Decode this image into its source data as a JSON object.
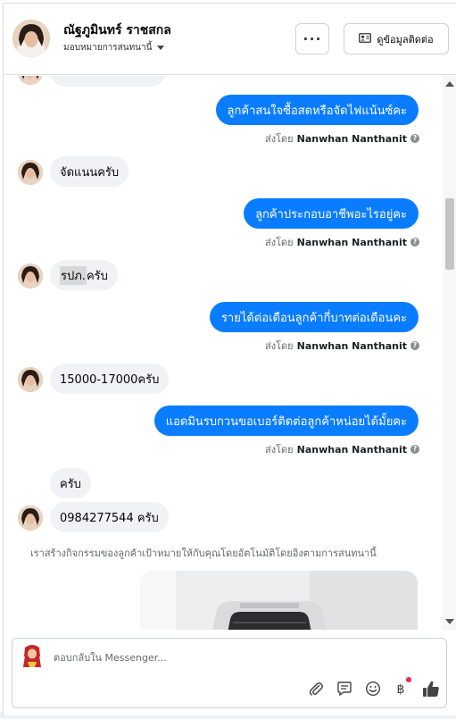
{
  "header": {
    "name": "ณัฐภูมินทร์ ราชสกล",
    "subtitle": "มอบหมายการสนทนานี้",
    "more_label": "···",
    "contact_label": "ดูข้อมูลติดต่อ"
  },
  "messages": [
    {
      "dir": "out",
      "text": "ลูกค้าสนใจซื้อสดหรือจัดไฟแน้นซ์คะ",
      "sent_by_prefix": "ส่งโดย",
      "sent_by_name": "Nanwhan Nanthanit"
    },
    {
      "dir": "in",
      "text": "จัดแนนครับ"
    },
    {
      "dir": "out",
      "text": "ลูกค้าประกอบอาชีพอะไรอยู่คะ",
      "sent_by_prefix": "ส่งโดย",
      "sent_by_name": "Nanwhan Nanthanit"
    },
    {
      "dir": "in",
      "text_highlight": "รปภ.",
      "text_rest": " ครับ"
    },
    {
      "dir": "out",
      "text": "รายได้ต่อเดือนลูกค้ากี่บาทต่อเดือนคะ",
      "sent_by_prefix": "ส่งโดย",
      "sent_by_name": "Nanwhan Nanthanit"
    },
    {
      "dir": "in",
      "text": "15000-17000ครับ"
    },
    {
      "dir": "out",
      "text": "แอดมินรบกวนขอเบอร์ติดต่อลูกค้าหน่อยได้มั้ยคะ",
      "sent_by_prefix": "ส่งโดย",
      "sent_by_name": "Nanwhan Nanthanit"
    },
    {
      "dir": "in",
      "text": "ครับ"
    },
    {
      "dir": "in",
      "text": "0984277544 ครับ"
    }
  ],
  "system_note": "เราสร้างกิจกรรมของลูกค้าเป้าหมายให้กับคุณโดยอัตโนมัติโดยอิงตามการสนทนานี้",
  "composer": {
    "placeholder": "ตอบกลับใน Messenger..."
  },
  "toolbar": {
    "icons": [
      "paperclip-icon",
      "note-icon",
      "emoji-icon",
      "baht-icon",
      "thumbs-up-icon"
    ]
  },
  "colors": {
    "outgoing_bubble": "#0a7cff",
    "incoming_bubble": "#f0f2f5",
    "notification_dot": "#f02849"
  }
}
